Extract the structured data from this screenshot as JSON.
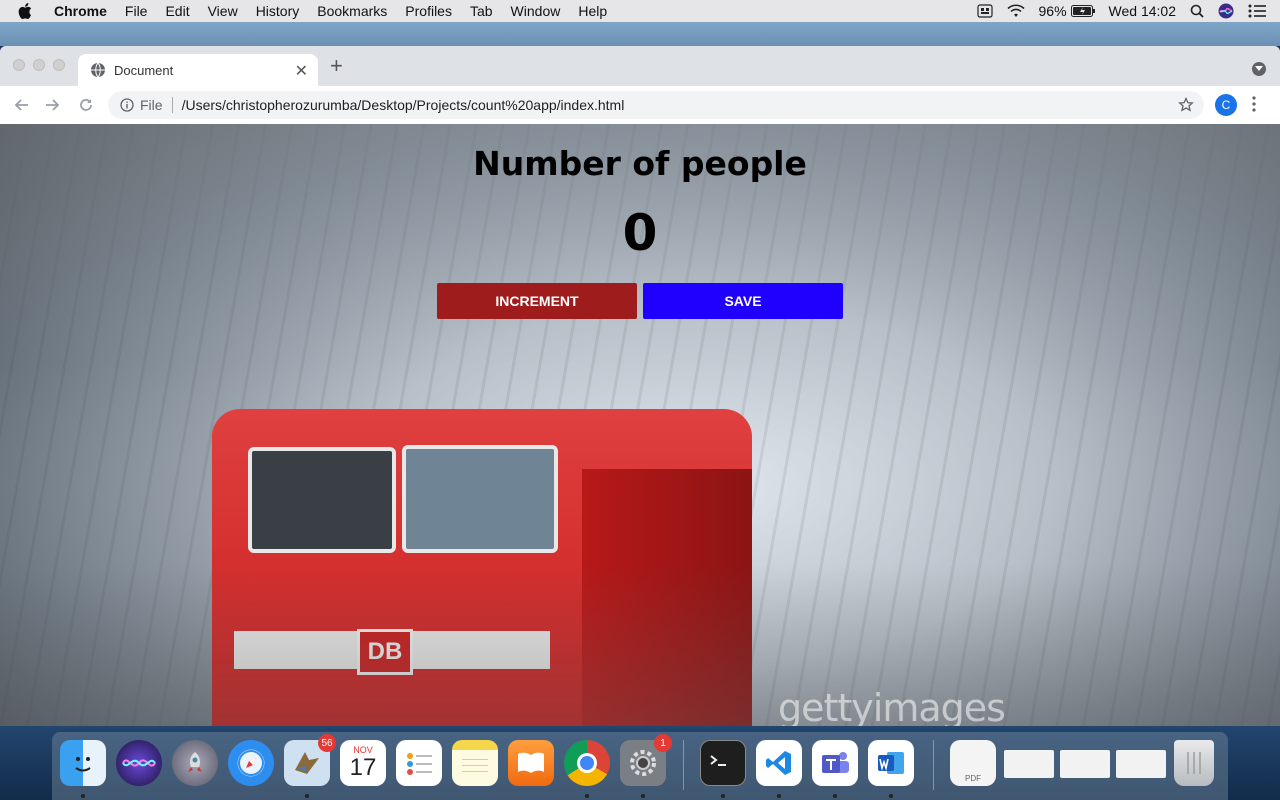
{
  "menubar": {
    "app_name": "Chrome",
    "items": [
      "File",
      "Edit",
      "View",
      "History",
      "Bookmarks",
      "Profiles",
      "Tab",
      "Window",
      "Help"
    ],
    "battery": "96%",
    "clock": "Wed 14:02"
  },
  "browser": {
    "tab_title": "Document",
    "url_scheme": "File",
    "url_path": "/Users/christopherozurumba/Desktop/Projects/count%20app/index.html",
    "profile_initial": "C"
  },
  "app": {
    "heading": "Number of people",
    "count": "0",
    "increment_label": "INCREMENT",
    "save_label": "SAVE",
    "watermark": "gettyimages"
  },
  "colors": {
    "increment_button": "#9e1c1c",
    "save_button": "#1f00ff"
  },
  "dock": {
    "icons": [
      "finder-icon",
      "siri-icon",
      "launchpad-icon",
      "safari-icon",
      "mail-icon",
      "calendar-icon",
      "reminders-icon",
      "notes-icon",
      "books-icon",
      "chrome-icon",
      "system-preferences-icon",
      "terminal-icon",
      "vscode-icon",
      "teams-icon",
      "word-icon",
      "pdf-document-icon",
      "window-thumbnail-icon",
      "window-thumbnail-icon",
      "window-thumbnail-icon",
      "trash-icon"
    ],
    "mail_badge": "56",
    "calendar_month": "NOV",
    "calendar_day": "17",
    "system_preferences_badge": "1",
    "pdf_label": "PDF"
  }
}
